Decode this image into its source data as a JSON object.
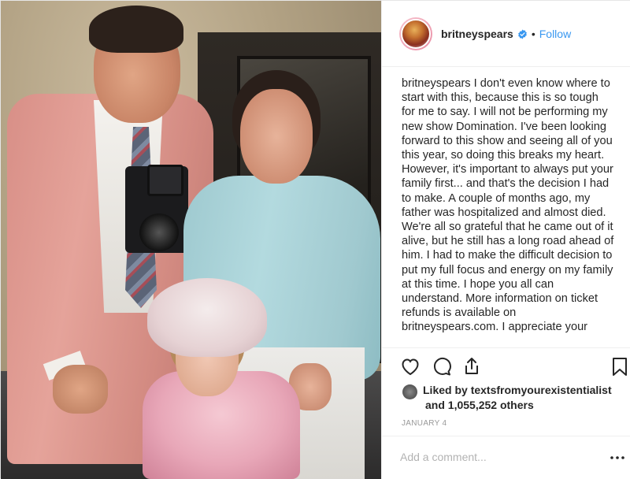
{
  "header": {
    "username": "britneyspears",
    "separator": "•",
    "follow_label": "Follow",
    "verified_color": "#3897f0"
  },
  "caption": {
    "username": "britneyspears",
    "text": " I don't even know where to start with this, because this is so tough for me to say. I will not be performing my new show Domination. I've been looking forward to this show and seeing all of you this year, so doing this breaks my heart. However, it's important to always put your family first... and that's the decision I had to make. A couple of months ago, my father was hospitalized and almost died. We're all so grateful that he came out of it alive, but he still has a long road ahead of him. I had to make the difficult decision to put my full focus and energy on my family at this time. I hope you all can understand. More information on ticket refunds is available on britneyspears.com. I appreciate your"
  },
  "actions": {
    "like_icon": "heart-icon",
    "comment_icon": "comment-icon",
    "share_icon": "share-icon",
    "save_icon": "bookmark-icon"
  },
  "likes": {
    "prefix": "Liked by ",
    "liker": "textsfromyourexistentialist",
    "others": "and 1,055,252 others"
  },
  "date": "JANUARY 4",
  "comment": {
    "placeholder": "Add a comment...",
    "more_icon": "more-options-icon"
  },
  "colors": {
    "link": "#3897f0",
    "text": "#262626",
    "muted": "#999999",
    "border": "#efefef"
  }
}
